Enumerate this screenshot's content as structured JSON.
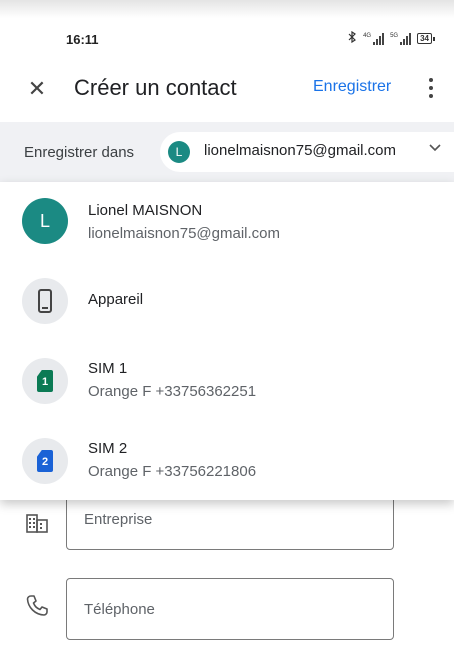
{
  "status_bar": {
    "time": "16:11",
    "icons": [
      "bluetooth-icon",
      "signal-4g-icon",
      "signal-5g-icon",
      "battery-icon"
    ],
    "net1": "4G",
    "net2": "5G",
    "battery": "34"
  },
  "app_bar": {
    "close_icon": "close-icon",
    "title": "Créer un contact",
    "save_label": "Enregistrer",
    "more_icon": "more-vert-icon"
  },
  "save_in": {
    "label": "Enregistrer dans",
    "account_initial": "L",
    "account_email": "lionelmaisnon75@gmail.com",
    "chevron_icon": "chevron-down-icon"
  },
  "accounts": [
    {
      "type": "google",
      "initial": "L",
      "name": "Lionel MAISNON",
      "detail": "lionelmaisnon75@gmail.com"
    },
    {
      "type": "device",
      "icon": "phone-icon",
      "name": "Appareil",
      "detail": ""
    },
    {
      "type": "sim",
      "icon": "sim-card-icon",
      "sim_number": "1",
      "sim_color": "#0b7a54",
      "name": "SIM 1",
      "detail": "Orange F +33756362251"
    },
    {
      "type": "sim",
      "icon": "sim-card-icon",
      "sim_number": "2",
      "sim_color": "#1a62d6",
      "name": "SIM 2",
      "detail": "Orange F +33756221806"
    }
  ],
  "form": {
    "company_icon": "business-icon",
    "company_placeholder": "Entreprise",
    "phone_icon": "phone-handset-icon",
    "phone_placeholder": "Téléphone"
  },
  "colors": {
    "accent": "#1a73e8",
    "avatar": "#1b8a83",
    "save_bar_bg": "#f0f1f4"
  }
}
